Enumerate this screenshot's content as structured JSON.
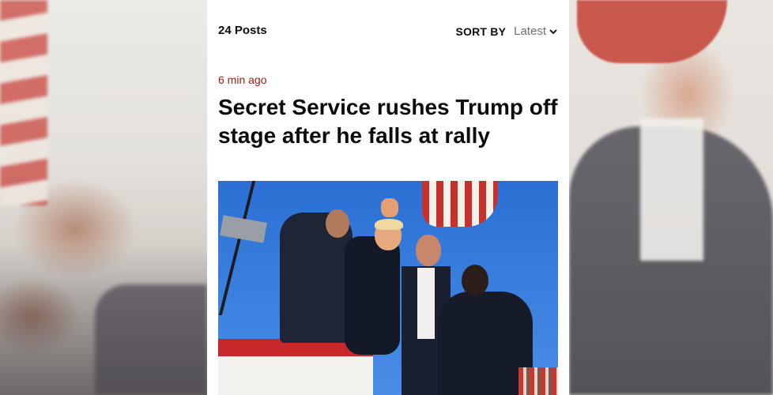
{
  "feed": {
    "posts_count": "24 Posts",
    "sort_label": "SORT BY",
    "sort_value": "Latest"
  },
  "post": {
    "timestamp": "6 min ago",
    "headline": "Secret Service rushes Trump off stage after he falls at rally"
  },
  "colors": {
    "timestamp": "#b0160f",
    "headline": "#0c0c0c",
    "sort_value": "#6f6f6f",
    "card_background": "#ffffff"
  },
  "icons": {
    "sort_toggle": "chevron-down-icon"
  }
}
